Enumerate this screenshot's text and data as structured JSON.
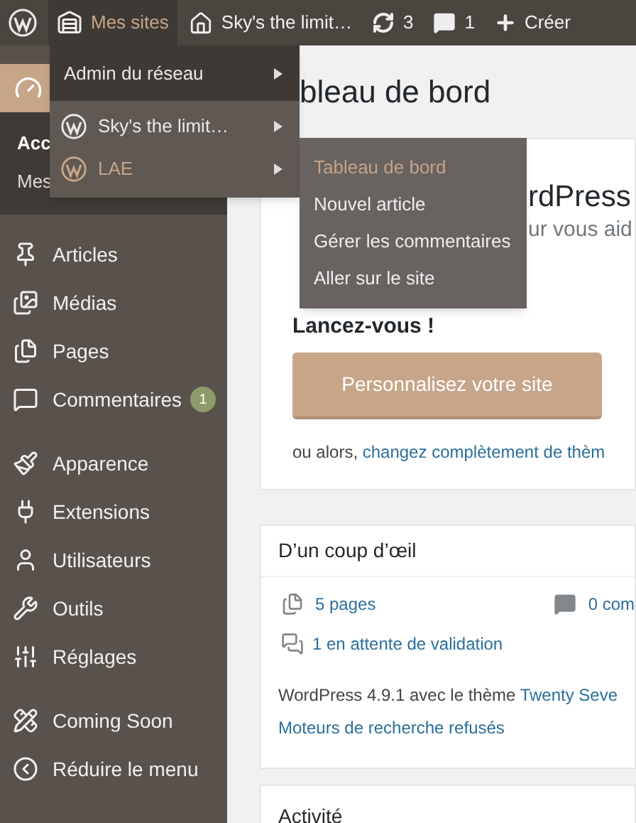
{
  "top_bar": [
    {
      "kind": "logo",
      "active": false
    },
    {
      "kind": "sites",
      "label": "Mes sites",
      "active": true
    },
    {
      "kind": "home",
      "label": "Sky's the limit…",
      "active": false
    },
    {
      "kind": "updates",
      "label": "3",
      "active": false
    },
    {
      "kind": "comments",
      "label": "1",
      "active": false
    },
    {
      "kind": "new",
      "label": "Créer",
      "active": false
    }
  ],
  "sites_menu": {
    "items": [
      {
        "kind": "network",
        "label": "Admin du réseau",
        "selected": false
      },
      {
        "kind": "site",
        "label": "Sky's the limit…",
        "color": "#e8e8e8",
        "selected": false
      },
      {
        "kind": "site",
        "label": "LAE",
        "color": "#c7a589",
        "selected": true
      }
    ]
  },
  "site_submenu": [
    {
      "label": "Tableau de bord",
      "selected": true
    },
    {
      "label": "Nouvel article",
      "selected": false
    },
    {
      "label": "Gérer les commentaires",
      "selected": false
    },
    {
      "label": "Aller sur le site",
      "selected": false
    }
  ],
  "sidebar": {
    "groups": [
      {
        "items": [
          {
            "kind": "dashboard",
            "selected": true,
            "children": [
              {
                "label": "Acc",
                "selected": true
              },
              {
                "label": "Mes",
                "selected": false
              }
            ]
          }
        ]
      },
      {
        "items": [
          {
            "kind": "articles",
            "label": "Articles",
            "selected": false
          },
          {
            "kind": "media",
            "label": "Médias",
            "selected": false
          },
          {
            "kind": "pages",
            "label": "Pages",
            "selected": false
          },
          {
            "kind": "comments",
            "label": "Commentaires",
            "badge": "1",
            "selected": false
          }
        ]
      },
      {
        "items": [
          {
            "kind": "appearance",
            "label": "Apparence",
            "selected": false
          },
          {
            "kind": "plugins",
            "label": "Extensions",
            "selected": false
          },
          {
            "kind": "users",
            "label": "Utilisateurs",
            "selected": false
          },
          {
            "kind": "tools",
            "label": "Outils",
            "selected": false
          },
          {
            "kind": "settings",
            "label": "Réglages",
            "selected": false
          }
        ]
      },
      {
        "items": [
          {
            "kind": "coming",
            "label": "Coming Soon",
            "selected": false
          },
          {
            "kind": "collapse",
            "label": "Réduire le menu",
            "selected": false
          }
        ]
      }
    ]
  },
  "page_title": "bleau de bord",
  "welcome": {
    "title": "rdPress",
    "subtitle": "ur vous aid",
    "heading": "Lancez-vous !",
    "button": "Personnalisez votre site",
    "alt_text": "ou alors, ",
    "alt_link": "changez complètement de thèm"
  },
  "glance": {
    "title": "D’un coup d’œil",
    "stats": [
      {
        "kind": "pages",
        "label": "5 pages"
      },
      {
        "kind": "comments",
        "label": "0 com"
      }
    ],
    "moderation": "1 en attente de validation",
    "version_text": "WordPress 4.9.1 avec le thème ",
    "theme_link": "Twenty Seve",
    "search_link": "Moteurs de recherche refusés"
  },
  "activity": {
    "title": "Activité"
  }
}
